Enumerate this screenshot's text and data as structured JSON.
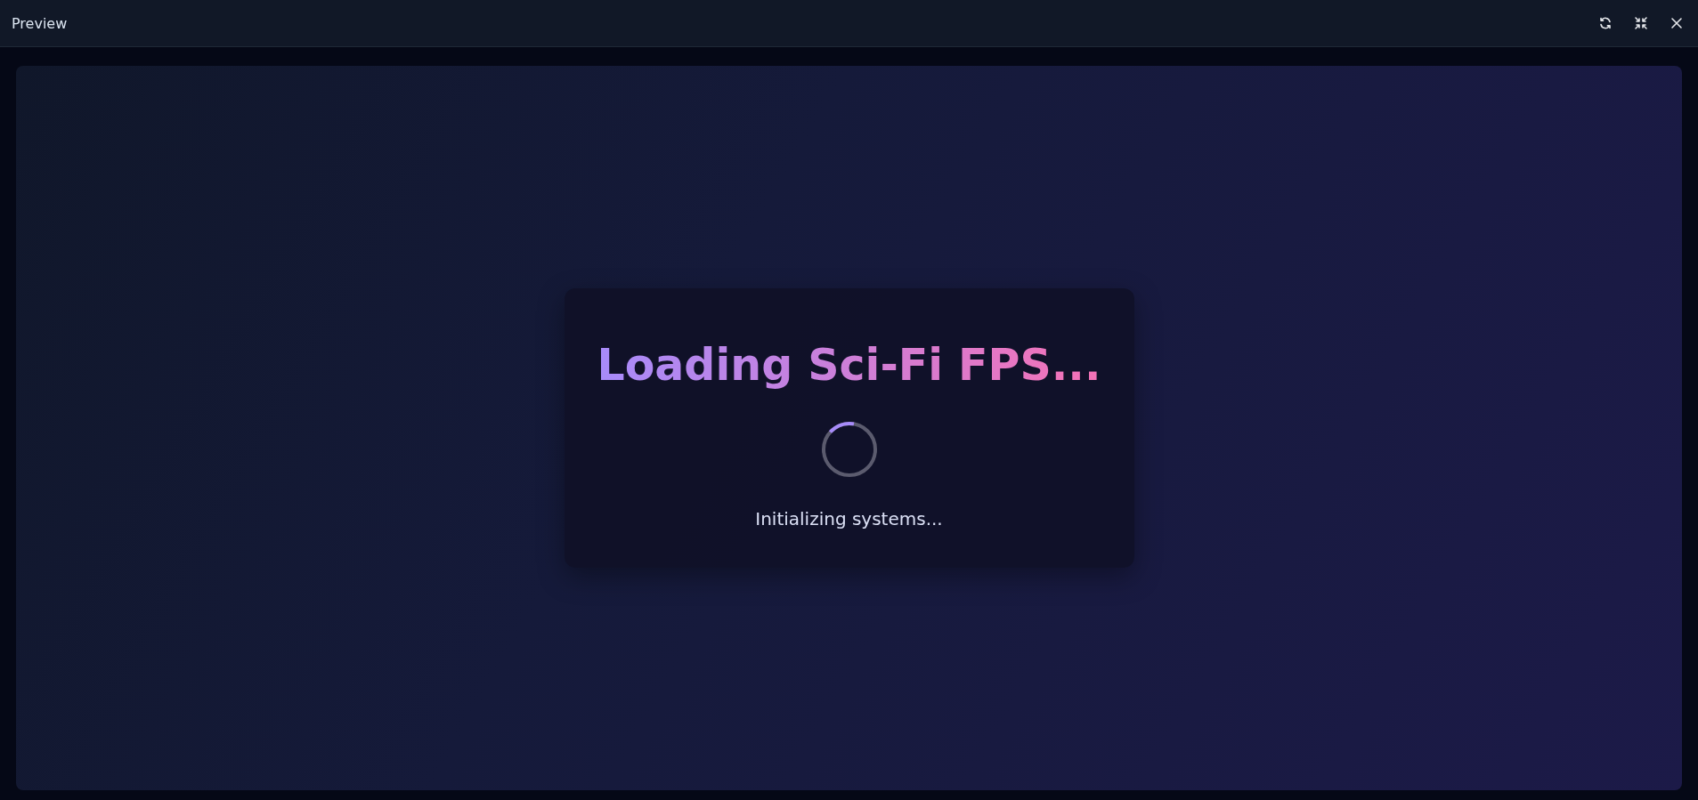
{
  "window": {
    "title": "Preview"
  },
  "toolbar": {
    "buttons": [
      {
        "kind": "refresh"
      },
      {
        "kind": "minimize"
      },
      {
        "kind": "close"
      }
    ]
  },
  "loading_card": {
    "title": "Loading Sci-Fi FPS...",
    "status": "Initializing systems..."
  }
}
